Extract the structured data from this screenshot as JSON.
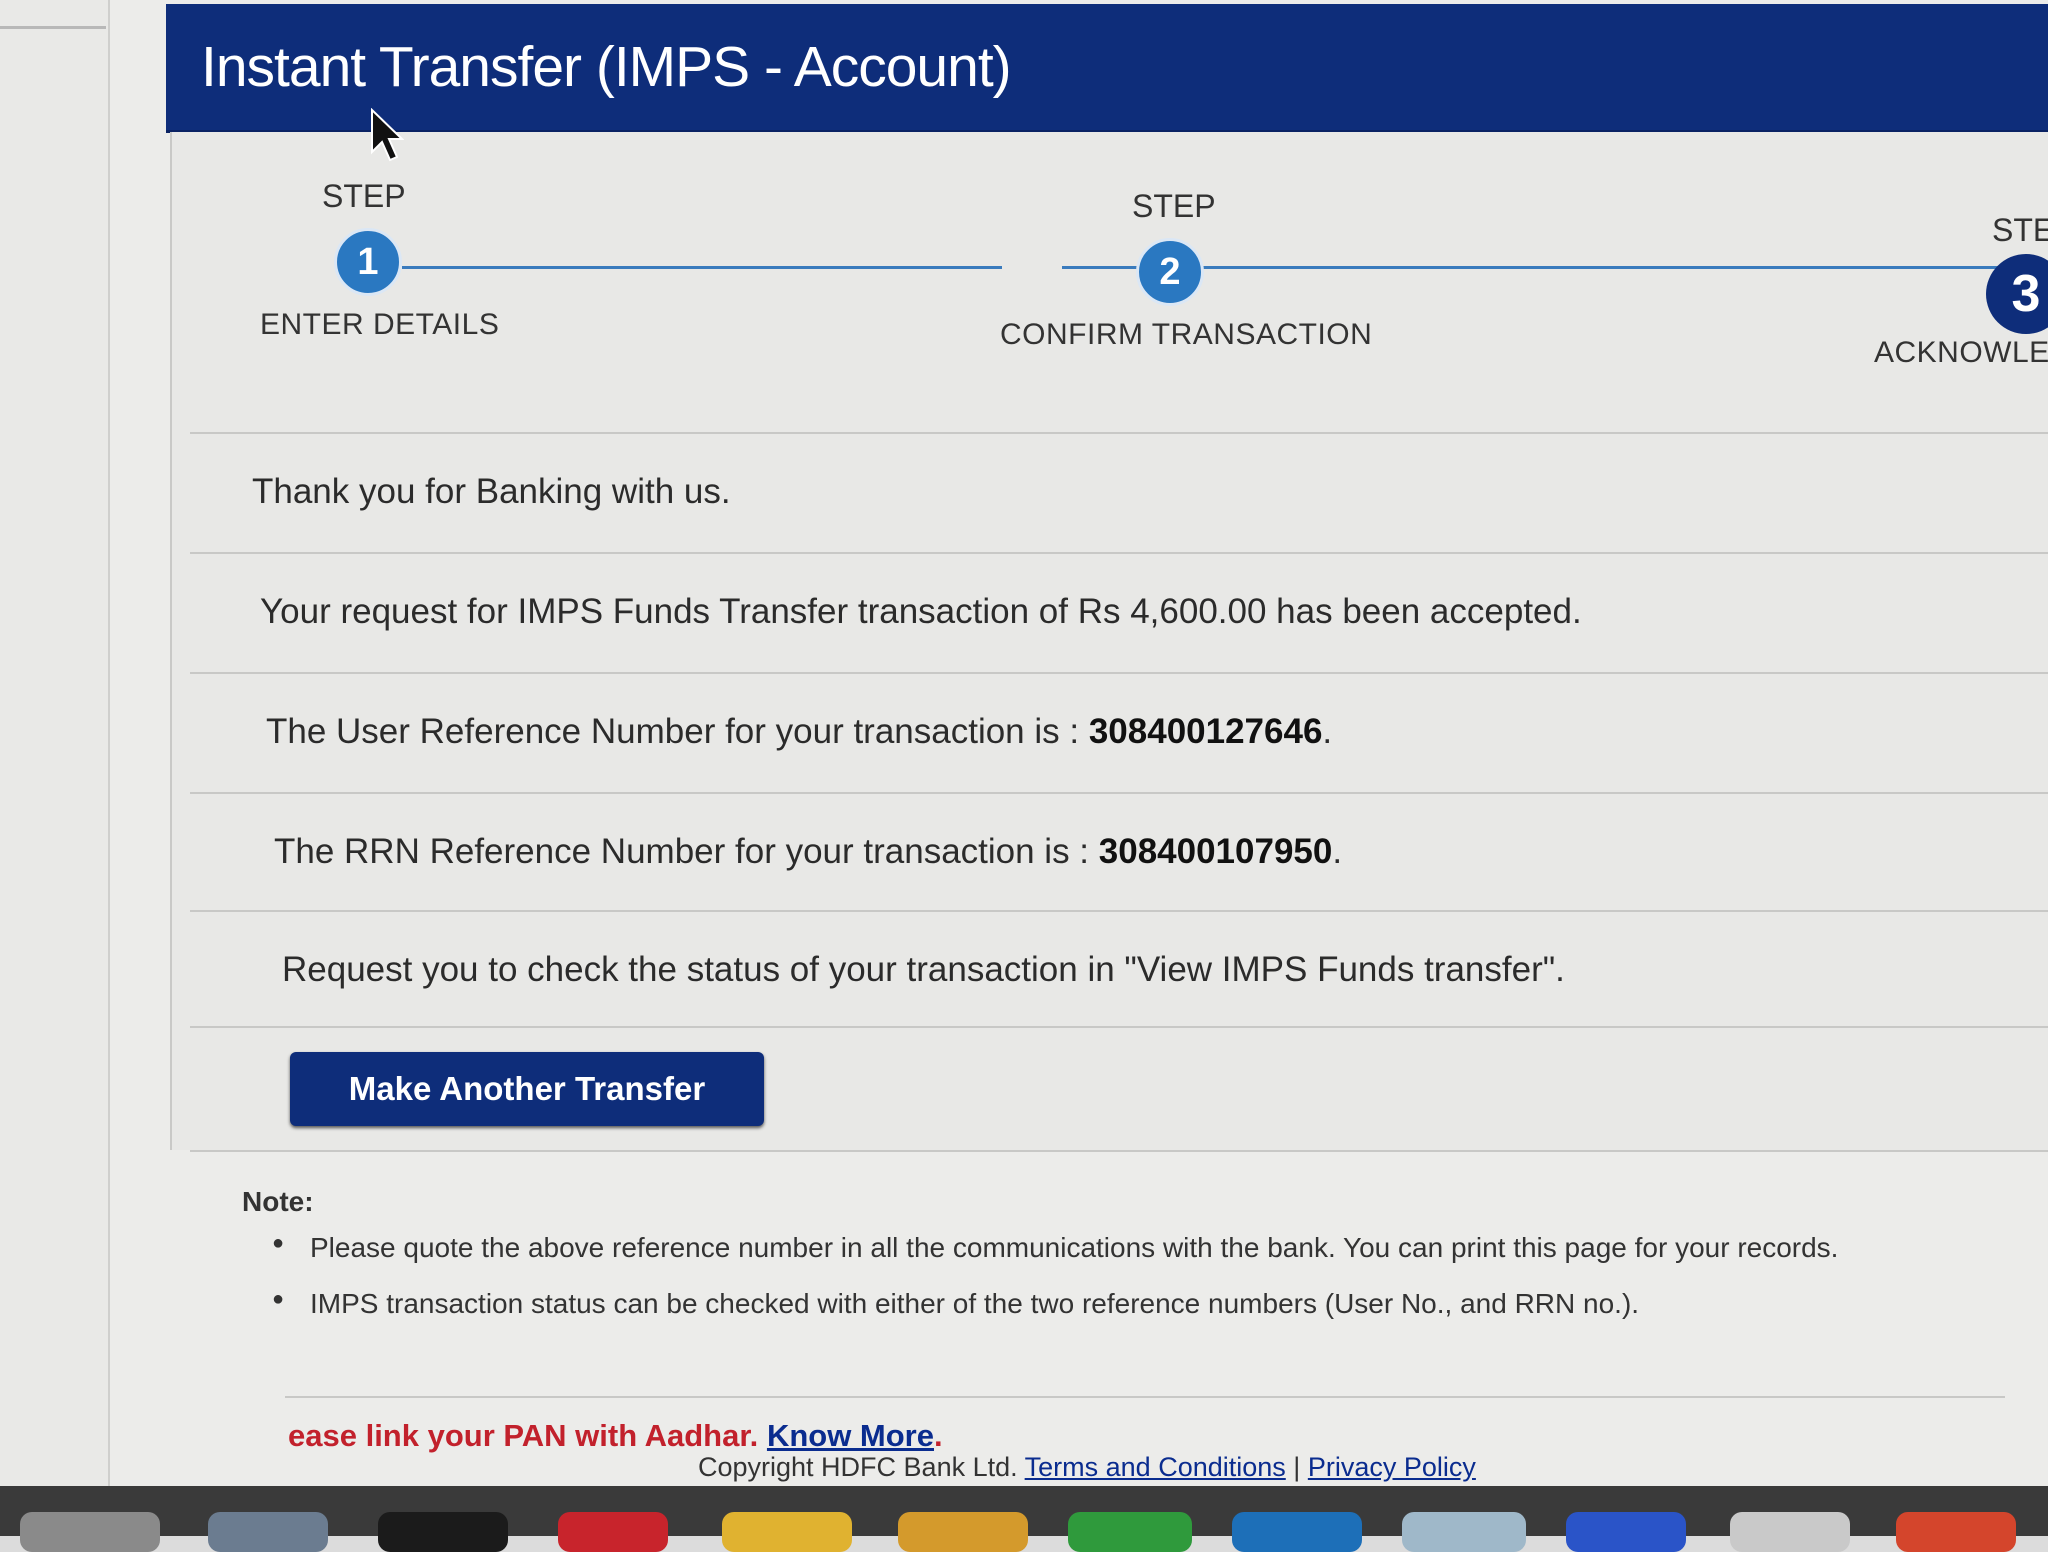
{
  "header": {
    "title": "Instant Transfer (IMPS - Account)"
  },
  "steps": [
    {
      "label": "STEP",
      "number": "1",
      "name": "ENTER DETAILS"
    },
    {
      "label": "STEP",
      "number": "2",
      "name": "CONFIRM TRANSACTION"
    },
    {
      "label": "STE",
      "number": "3",
      "name": "ACKNOWLED"
    }
  ],
  "messages": {
    "thanks": "Thank you for Banking with us.",
    "accepted": "Your request for IMPS Funds Transfer transaction of Rs 4,600.00 has been accepted.",
    "user_ref_prefix": "The User Reference Number for your transaction is : ",
    "user_ref_number": "308400127646",
    "rrn_prefix": "The RRN Reference Number for your transaction is : ",
    "rrn_number": "308400107950",
    "status_check": "Request you to check the status of your transaction in \"View IMPS Funds transfer\"."
  },
  "button": {
    "label": "Make Another Transfer"
  },
  "note": {
    "title": "Note:",
    "items": [
      "Please quote the above reference number in all the communications with the bank. You can print this page for your records.",
      "IMPS transaction status can be checked with either of the two reference numbers (User No., and RRN no.)."
    ]
  },
  "footer": {
    "pan_text": "ease link your PAN with Aadhar.",
    "know_more": "Know More",
    "copyright": "Copyright HDFC Bank Ltd.",
    "terms": "Terms and Conditions",
    "separator": "|",
    "privacy": "Privacy Policy"
  },
  "colors": {
    "header_bg": "#0e2d7a",
    "step_blue": "#2a78c1",
    "pan_red": "#c2212c"
  }
}
